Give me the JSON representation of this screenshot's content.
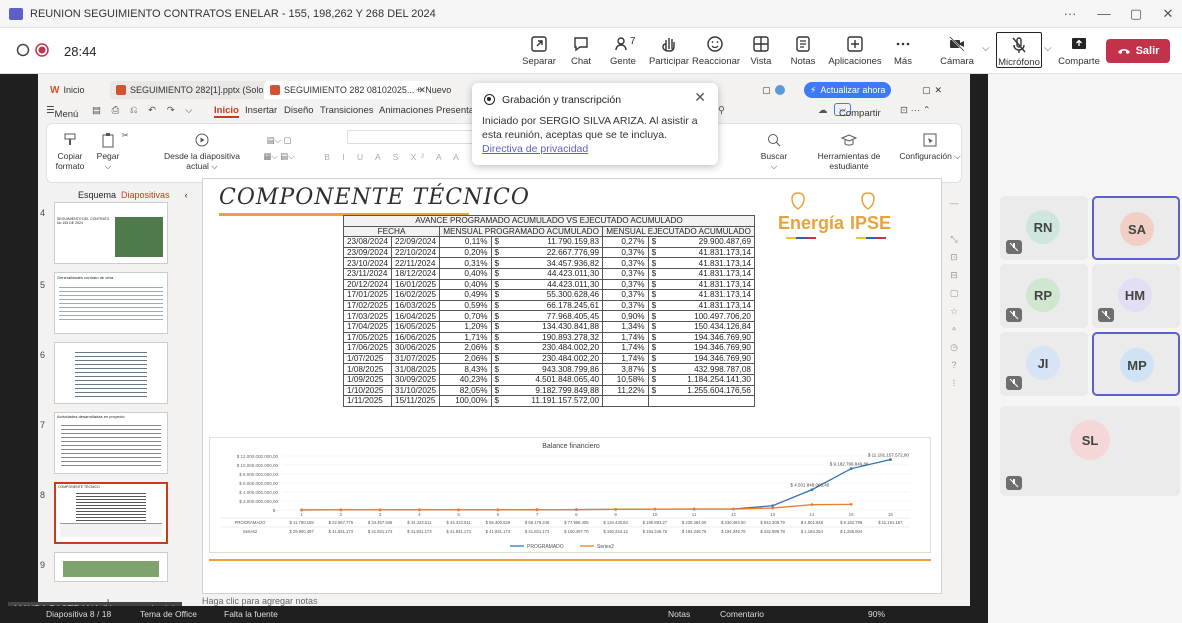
{
  "window": {
    "title": "REUNION SEGUIMIENTO CONTRATOS ENELAR - 155, 198,262 Y 268 DEL 2024"
  },
  "meeting": {
    "timer": "28:44",
    "controls": [
      {
        "label": "Separar"
      },
      {
        "label": "Chat"
      },
      {
        "label": "Gente",
        "count": "7"
      },
      {
        "label": "Participar"
      },
      {
        "label": "Reaccionar"
      },
      {
        "label": "Vista"
      },
      {
        "label": "Notas"
      },
      {
        "label": "Aplicaciones"
      },
      {
        "label": "Más"
      },
      {
        "label": "Cámara"
      },
      {
        "label": "Micrófono"
      },
      {
        "label": "Comparte"
      }
    ],
    "leave": "Salir"
  },
  "ppt": {
    "tabs": [
      "Inicio",
      "SEGUIMIENTO 282[1].pptx (Solo lect...",
      "SEGUIMIENTO 282 08102025...",
      "Nuevo"
    ],
    "ribbon_menu": [
      "Menú",
      "Inicio",
      "Insertar",
      "Diseño",
      "Transiciones",
      "Animaciones",
      "Presentación"
    ],
    "update": "Actualizar ahora",
    "share": "Compartir",
    "ribbon": [
      {
        "label": "Copiar formato"
      },
      {
        "label": "Pegar"
      },
      {
        "label": "Desde la diapositiva actual"
      },
      {
        "label": "Buscar"
      },
      {
        "label": "Herramientas de estudiante"
      },
      {
        "label": "Configuración"
      }
    ],
    "thumbs_head": {
      "outline": "Esquema",
      "slides": "Diapositivas"
    },
    "thumb_numbers": [
      "4",
      "5",
      "6",
      "7",
      "8",
      "9"
    ],
    "thumb_titles": [
      "SEGUIMIENTO DEL CONTRATO No 155 DE 2024",
      "Generalidades contrato de obra",
      "",
      "Actividades desarrolladas en proyecto",
      "COMPONENTE TÉCNICO",
      ""
    ],
    "notes_placeholder": "Haga clic para agregar notas",
    "status": {
      "slide": "Diapositiva 8 / 18",
      "theme": "Tema de Office",
      "font": "Falta la fuente",
      "notes": "Notas",
      "comments": "Comentario",
      "zoom": "90%"
    }
  },
  "slide": {
    "title": "COMPONENTE TÉCNICO",
    "table": {
      "title": "AVANCE PROGRAMADO ACUMULADO VS EJECUTADO ACUMULADO",
      "headers": [
        "FECHA",
        "MENSUAL PROGRAMADO ACUMULADO",
        "MENSUAL EJECUTADO ACUMULADO"
      ],
      "rows": [
        [
          "23/08/2024",
          "22/09/2024",
          "0,11%",
          "$",
          "11.790.159,83",
          "0,27%",
          "$",
          "29.900.487,69"
        ],
        [
          "23/09/2024",
          "22/10/2024",
          "0,20%",
          "$",
          "22.667.776,99",
          "0,37%",
          "$",
          "41.831.173,14"
        ],
        [
          "23/10/2024",
          "22/11/2024",
          "0,31%",
          "$",
          "34.457.936,82",
          "0,37%",
          "$",
          "41.831.173,14"
        ],
        [
          "23/11/2024",
          "18/12/2024",
          "0,40%",
          "$",
          "44.423.011,30",
          "0,37%",
          "$",
          "41.831.173,14"
        ],
        [
          "20/12/2024",
          "16/01/2025",
          "0,40%",
          "$",
          "44.423.011,30",
          "0,37%",
          "$",
          "41.831.173,14"
        ],
        [
          "17/01/2025",
          "16/02/2025",
          "0,49%",
          "$",
          "55.300.628,46",
          "0,37%",
          "$",
          "41.831.173,14"
        ],
        [
          "17/02/2025",
          "16/03/2025",
          "0,59%",
          "$",
          "66.178.245,61",
          "0,37%",
          "$",
          "41.831.173,14"
        ],
        [
          "17/03/2025",
          "16/04/2025",
          "0,70%",
          "$",
          "77.968.405,45",
          "0,90%",
          "$",
          "100.497.706,20"
        ],
        [
          "17/04/2025",
          "16/05/2025",
          "1,20%",
          "$",
          "134.430.841,88",
          "1,34%",
          "$",
          "150.434.126,84"
        ],
        [
          "17/05/2025",
          "16/06/2025",
          "1,71%",
          "$",
          "190.893.278,32",
          "1,74%",
          "$",
          "194.346.769,90"
        ],
        [
          "17/06/2025",
          "30/06/2025",
          "2,06%",
          "$",
          "230.484.002,20",
          "1,74%",
          "$",
          "194.346.769,90"
        ],
        [
          "1/07/2025",
          "31/07/2025",
          "2,06%",
          "$",
          "230.484.002,20",
          "1,74%",
          "$",
          "194.346.769,90"
        ],
        [
          "1/08/2025",
          "31/08/2025",
          "8,43%",
          "$",
          "943.308.799,86",
          "3,87%",
          "$",
          "432.998.787,08"
        ],
        [
          "1/09/2025",
          "30/09/2025",
          "40,23%",
          "$",
          "4.501.848.065,40",
          "10,58%",
          "$",
          "1.184.254.141,30"
        ],
        [
          "1/10/2025",
          "31/10/2025",
          "82,05%",
          "$",
          "9.182.799.849,88",
          "11,22%",
          "$",
          "1.255.604.176,56"
        ],
        [
          "1/11/2025",
          "15/11/2025",
          "100,00%",
          "$",
          "11.191.157.572,00",
          "",
          "",
          ""
        ]
      ]
    },
    "logos": {
      "energia": "Energía",
      "ipse": "IPSE"
    }
  },
  "chart_data": {
    "type": "line",
    "title": "Balance financiero",
    "categories": [
      "1",
      "2",
      "3",
      "4",
      "5",
      "6",
      "7",
      "8",
      "9",
      "10",
      "11",
      "12",
      "13",
      "14",
      "15",
      "16"
    ],
    "yticks": [
      "$ 12.000.000.000,00",
      "$ 10.000.000.000,00",
      "$ 8.000.000.000,00",
      "$ 6.000.000.000,00",
      "$ 4.000.000.000,00",
      "$ 2.000.000.000,00",
      "$ -"
    ],
    "ylim": [
      0,
      12000000000
    ],
    "series": [
      {
        "name": "PROGRAMADO",
        "color": "#2e75b6",
        "values": [
          11790159.83,
          22667776.99,
          34457936.82,
          44423011.3,
          44423011.3,
          55300628.46,
          66178245.61,
          77968405.45,
          134430841.88,
          190893278.32,
          230484002.2,
          230484002.2,
          943308799.86,
          4501848065.4,
          9182799849.88,
          11191157572.0
        ]
      },
      {
        "name": "Series2",
        "color": "#ed7d31",
        "values": [
          29900487.69,
          41831173.14,
          41831173.14,
          41831173.14,
          41831173.14,
          41831173.14,
          41831173.14,
          100497706.2,
          150434126.84,
          194346769.9,
          194346769.9,
          194346769.9,
          432998787.08,
          1184254141.3,
          1255604176.56,
          null
        ]
      }
    ],
    "table_rows": [
      [
        "PROGRAMADO",
        "$ 11.790.159",
        "$ 22.667.776",
        "$ 34.457.936",
        "$ 44.423.011",
        "$ 44.423.011",
        "$ 55.300.628",
        "$ 66.178.245",
        "$ 77.968.405",
        "$ 134.430.84",
        "$ 190.893.27",
        "$ 230.484.00",
        "$ 230.484.00",
        "$ 943.308.79",
        "$ 4.501.848",
        "$ 9.182.799",
        "$ 11.191.157"
      ],
      [
        "Series2",
        "$ 29.900.487",
        "$ 41.831.173",
        "$ 41.831.173",
        "$ 41.831.173",
        "$ 41.831.173",
        "$ 41.831.173",
        "$ 41.831.173",
        "$ 100.497.70",
        "$ 150.434.12",
        "$ 194.346.76",
        "$ 194.346.76",
        "$ 194.346.76",
        "$ 432.998.78",
        "$ 1.184.254",
        "$ 1.255.604",
        ""
      ]
    ],
    "point_labels": [
      "$ 11.191.157.572,00",
      "$ 9.182.799.849,88",
      "$ 4.501.848.065,40"
    ],
    "legend": [
      "PROGRAMADO",
      "Series2"
    ]
  },
  "popup": {
    "title": "Grabación y transcripción",
    "body": "Iniciado por SERGIO SILVA ARIZA. Al asistir a esta reunión, aceptas que se te incluya.",
    "link": "Directiva de privacidad"
  },
  "participants": [
    {
      "initials": "RN",
      "color": "#cfe6e0",
      "active": false
    },
    {
      "initials": "SA",
      "color": "#f2cfc4",
      "active": true
    },
    {
      "initials": "RP",
      "color": "#cfe6cf",
      "active": false
    },
    {
      "initials": "HM",
      "color": "#e3def2",
      "active": false
    },
    {
      "initials": "JI",
      "color": "#d6e4f5",
      "active": false
    },
    {
      "initials": "MP",
      "color": "#cfe3f5",
      "active": true
    },
    {
      "initials": "SL",
      "color": "#f5d7d7",
      "active": false
    }
  ],
  "caption": "MAYRA PASTRANA (No comprobado)"
}
